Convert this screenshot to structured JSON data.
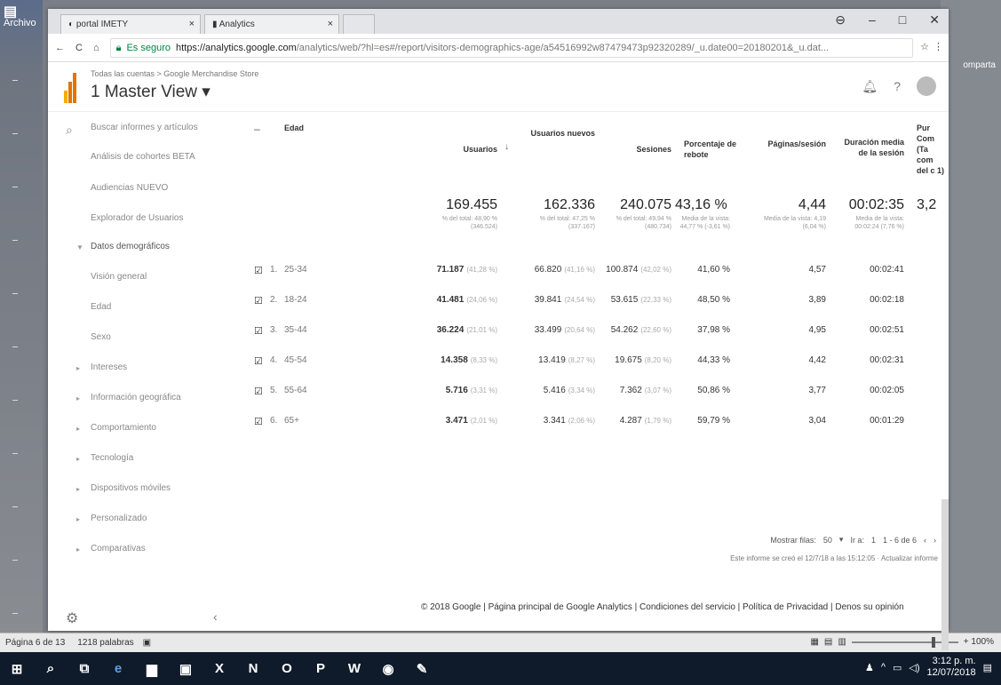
{
  "word": {
    "app_label": "Archivo",
    "right_label": "omparta",
    "status_page": "Página 6 de 13",
    "status_words": "1218 palabras",
    "zoom": "+ 100%"
  },
  "taskbar": {
    "time": "3:12 p. m.",
    "date": "12/07/2018"
  },
  "browser": {
    "tabs": [
      {
        "label": "portal IMETY"
      },
      {
        "label": "Analytics"
      }
    ],
    "secure_label": "Es seguro",
    "url_host": "https://analytics.google.com",
    "url_path": "/analytics/web/?hl=es#/report/visitors-demographics-age/a54516992w87479473p92320289/_u.date00=20180201&_u.dat..."
  },
  "ga": {
    "breadcrumb": "Todas las cuentas > Google Merchandise Store",
    "view_title": "1 Master View ▾"
  },
  "sidebar": {
    "search_placeholder": "Buscar informes y artículos",
    "items": [
      {
        "label": "Análisis de cohortes BETA"
      },
      {
        "label": "Audiencias NUEVO"
      },
      {
        "label": "Explorador de Usuarios"
      },
      {
        "label": "Datos demográficos"
      },
      {
        "label": "Visión general"
      },
      {
        "label": "Edad"
      },
      {
        "label": "Sexo"
      },
      {
        "label": "Intereses"
      },
      {
        "label": "Información geográfica"
      },
      {
        "label": "Comportamiento"
      },
      {
        "label": "Tecnología"
      },
      {
        "label": "Dispositivos móviles"
      },
      {
        "label": "Personalizado"
      },
      {
        "label": "Comparativas"
      }
    ]
  },
  "table": {
    "dim_header": "Edad",
    "headers": {
      "users": "Usuarios",
      "new_users": "Usuarios nuevos",
      "sessions": "Sesiones",
      "bounce": "Porcentaje de rebote",
      "pages": "Páginas/sesión",
      "duration": "Duración media de la sesión",
      "extra": "Pur Com (Ta com del c 1)"
    },
    "totals": {
      "users": "169.455",
      "users_sub": "% del total: 48,90 % (346.524)",
      "new_users": "162.336",
      "new_users_sub": "% del total: 47,25 % (337.167)",
      "sessions": "240.075",
      "sessions_sub": "% del total: 49,94 % (480.734)",
      "bounce": "43,16 %",
      "bounce_sub": "Media de la vista: 44,77 % (-3,61 %)",
      "pages": "4,44",
      "pages_sub": "Media de la vista: 4,19 (6,04 %)",
      "duration": "00:02:35",
      "duration_sub": "Media de la vista: 00:02:24 (7,76 %)",
      "extra": "3,2"
    },
    "rows": [
      {
        "idx": "1.",
        "age": "25-34",
        "users": "71.187",
        "users_pct": "(41,28 %)",
        "new_users": "66.820",
        "new_users_pct": "(41,16 %)",
        "sessions": "100.874",
        "sessions_pct": "(42,02 %)",
        "bounce": "41,60 %",
        "pages": "4,57",
        "duration": "00:02:41"
      },
      {
        "idx": "2.",
        "age": "18-24",
        "users": "41.481",
        "users_pct": "(24,06 %)",
        "new_users": "39.841",
        "new_users_pct": "(24,54 %)",
        "sessions": "53.615",
        "sessions_pct": "(22,33 %)",
        "bounce": "48,50 %",
        "pages": "3,89",
        "duration": "00:02:18"
      },
      {
        "idx": "3.",
        "age": "35-44",
        "users": "36.224",
        "users_pct": "(21,01 %)",
        "new_users": "33.499",
        "new_users_pct": "(20,64 %)",
        "sessions": "54.262",
        "sessions_pct": "(22,60 %)",
        "bounce": "37,98 %",
        "pages": "4,95",
        "duration": "00:02:51"
      },
      {
        "idx": "4.",
        "age": "45-54",
        "users": "14.358",
        "users_pct": "(8,33 %)",
        "new_users": "13.419",
        "new_users_pct": "(8,27 %)",
        "sessions": "19.675",
        "sessions_pct": "(8,20 %)",
        "bounce": "44,33 %",
        "pages": "4,42",
        "duration": "00:02:31"
      },
      {
        "idx": "5.",
        "age": "55-64",
        "users": "5.716",
        "users_pct": "(3,31 %)",
        "new_users": "5.416",
        "new_users_pct": "(3,34 %)",
        "sessions": "7.362",
        "sessions_pct": "(3,07 %)",
        "bounce": "50,86 %",
        "pages": "3,77",
        "duration": "00:02:05"
      },
      {
        "idx": "6.",
        "age": "65+",
        "users": "3.471",
        "users_pct": "(2,01 %)",
        "new_users": "3.341",
        "new_users_pct": "(2,06 %)",
        "sessions": "4.287",
        "sessions_pct": "(1,79 %)",
        "bounce": "59,79 %",
        "pages": "3,04",
        "duration": "00:01:29"
      }
    ],
    "show_rows_label": "Mostrar filas:",
    "show_rows_value": "50",
    "goto_label": "Ir a:",
    "goto_value": "1",
    "range": "1 - 6 de 6",
    "report_note": "Este informe se creó el 12/7/18 a las 15:12:05 · Actualizar informe"
  },
  "footer": {
    "text": "© 2018 Google | Página principal de Google Analytics | Condiciones del servicio | Política de Privacidad | Denos su opinión"
  }
}
